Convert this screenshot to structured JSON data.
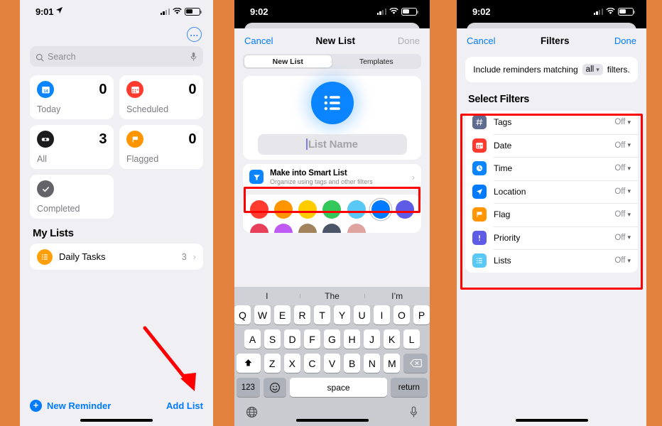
{
  "background_color": "#E2823E",
  "annotation_color": "#FF0000",
  "panel1": {
    "status": {
      "time": "9:01",
      "location_icon": "location-arrow-icon",
      "signal": "cellular-signal-icon",
      "wifi": "wifi-icon",
      "battery": "battery-icon"
    },
    "more_button": "…",
    "search": {
      "placeholder": "Search",
      "search_icon": "search-icon",
      "mic_icon": "microphone-icon"
    },
    "tiles": [
      {
        "label": "Today",
        "count": "0",
        "icon": "calendar-today-icon",
        "color": "#0A84FF"
      },
      {
        "label": "Scheduled",
        "count": "0",
        "icon": "calendar-scheduled-icon",
        "color": "#FF3B30"
      },
      {
        "label": "All",
        "count": "3",
        "icon": "all-inbox-icon",
        "color": "#1C1C1E"
      },
      {
        "label": "Flagged",
        "count": "0",
        "icon": "flag-icon",
        "color": "#FF9500"
      },
      {
        "label": "Completed",
        "count": "",
        "icon": "checkmark-circle-icon",
        "color": "#636369"
      }
    ],
    "my_lists_title": "My Lists",
    "lists": [
      {
        "name": "Daily Tasks",
        "count": "3",
        "icon": "list-bullet-icon",
        "color": "#FF9F0A",
        "chevron": "›"
      }
    ],
    "footer": {
      "new_reminder": "New Reminder",
      "plus": "+",
      "add_list": "Add List"
    }
  },
  "panel2": {
    "status": {
      "time": "9:02"
    },
    "nav": {
      "cancel": "Cancel",
      "title": "New List",
      "done": "Done"
    },
    "segments": [
      {
        "label": "New List",
        "active": true
      },
      {
        "label": "Templates",
        "active": false
      }
    ],
    "list_icon": "list-bullet-icon",
    "list_name_input": {
      "value": "",
      "placeholder": "List Name"
    },
    "smart_list": {
      "title": "Make into Smart List",
      "subtitle": "Organize using tags and other filters",
      "icon": "smart-list-icon",
      "chevron": "›"
    },
    "colors_row1": [
      "#FF3B30",
      "#FF9500",
      "#FFCC00",
      "#34C759",
      "#5AC8F5",
      "#007AFF",
      "#5E5CE6"
    ],
    "colors_row2": [
      "#E8405A",
      "#BF5AF2",
      "#A1845C",
      "#4A5568",
      "#DFA3A0"
    ],
    "selected_color": "#007AFF",
    "keyboard": {
      "predictions": [
        "I",
        "The",
        "I’m"
      ],
      "row1": [
        "Q",
        "W",
        "E",
        "R",
        "T",
        "Y",
        "U",
        "I",
        "O",
        "P"
      ],
      "row2": [
        "A",
        "S",
        "D",
        "F",
        "G",
        "H",
        "J",
        "K",
        "L"
      ],
      "row3": [
        "Z",
        "X",
        "C",
        "V",
        "B",
        "N",
        "M"
      ],
      "shift": "shift-icon",
      "backspace": "backspace-icon",
      "numbers": "123",
      "emoji": "emoji-icon",
      "space": "space",
      "return": "return",
      "globe": "globe-icon",
      "dictation": "microphone-icon"
    }
  },
  "panel3": {
    "status": {
      "time": "9:02"
    },
    "nav": {
      "cancel": "Cancel",
      "title": "Filters",
      "done": "Done"
    },
    "include": {
      "prefix": "Include reminders matching",
      "value": "all",
      "suffix": "filters."
    },
    "select_filters_title": "Select Filters",
    "filters": [
      {
        "label": "Tags",
        "value": "Off",
        "icon": "hashtag-icon",
        "color": "#5F6B8F"
      },
      {
        "label": "Date",
        "value": "Off",
        "icon": "calendar-icon",
        "color": "#FF3B30"
      },
      {
        "label": "Time",
        "value": "Off",
        "icon": "clock-icon",
        "color": "#0A84FF"
      },
      {
        "label": "Location",
        "value": "Off",
        "icon": "location-icon",
        "color": "#007AFF"
      },
      {
        "label": "Flag",
        "value": "Off",
        "icon": "flag-icon",
        "color": "#FF9500"
      },
      {
        "label": "Priority",
        "value": "Off",
        "icon": "priority-icon",
        "color": "#5E5CE6"
      },
      {
        "label": "Lists",
        "value": "Off",
        "icon": "list-bullet-icon",
        "color": "#5AC8F5"
      }
    ]
  }
}
